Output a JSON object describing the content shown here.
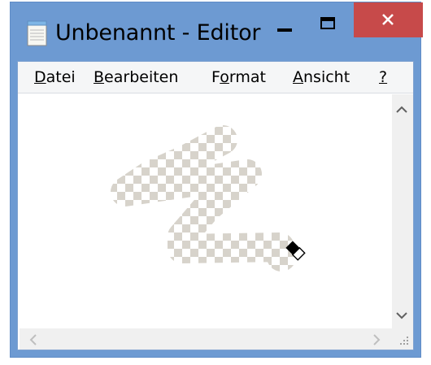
{
  "window": {
    "title": "Unbenannt - Editor",
    "app_icon": "notepad-icon",
    "controls": {
      "minimize_icon": "minimize-icon",
      "maximize_icon": "maximize-icon",
      "close_icon": "close-icon"
    }
  },
  "menu": {
    "items": [
      {
        "id": "datei",
        "access_key": "D",
        "rest": "atei",
        "full": "Datei"
      },
      {
        "id": "bearbeiten",
        "access_key": "B",
        "rest": "earbeiten",
        "full": "Bearbeiten"
      },
      {
        "id": "format",
        "pre": "F",
        "access_key": "o",
        "rest": "rmat",
        "full": "Format"
      },
      {
        "id": "ansicht",
        "access_key": "A",
        "rest": "nsicht",
        "full": "Ansicht"
      },
      {
        "id": "help",
        "access_key": "?",
        "rest": "",
        "full": "?"
      }
    ]
  },
  "editor": {
    "text": "",
    "cursor": "eraser-cursor"
  },
  "scrollbars": {
    "up_icon": "chevron-up-icon",
    "down_icon": "chevron-down-icon",
    "left_icon": "chevron-left-icon",
    "right_icon": "chevron-right-icon",
    "grip_icon": "size-grip-icon"
  },
  "colors": {
    "frame": "#6d9ad2",
    "close_button": "#c74a4a",
    "menubar": "#f5f6f7",
    "scrollbar": "#f0f0f0",
    "erased_checker_light": "#ffffff",
    "erased_checker_dark": "#d7d3cb"
  }
}
